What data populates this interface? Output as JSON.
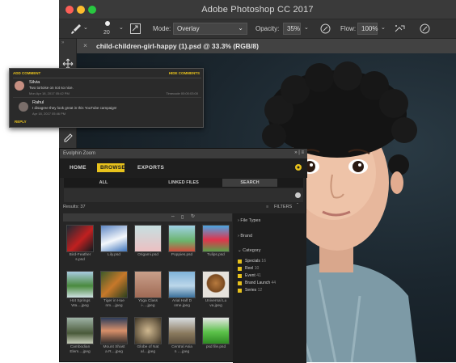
{
  "app": {
    "title": "Adobe Photoshop CC 2017"
  },
  "options": {
    "brush_size": "20",
    "mode_label": "Mode:",
    "mode_value": "Overlay",
    "opacity_label": "Opacity:",
    "opacity_value": "35%",
    "flow_label": "Flow:",
    "flow_value": "100%"
  },
  "document": {
    "tab_title": "child-children-girl-happy (1).psd @ 33.3% (RGB/8)"
  },
  "comments": {
    "add_label": "ADD COMMENT",
    "hide_label": "HIDE COMMENTS",
    "items": [
      {
        "author": "Silvia",
        "text": "Two tortoise on not so nice.",
        "date": "Mon Apr 18, 2017 05:42 PM",
        "timecode": "Timecode 00:00:03:00"
      },
      {
        "author": "Rahul",
        "text": "I disagree they look great in this YouTube campaign!",
        "date": "Apr 18, 2017 05:46 PM"
      }
    ],
    "reply_label": "REPLY"
  },
  "evolphin": {
    "panel_title": "Evolphin Zoom",
    "nav": {
      "home": "HOME",
      "browse": "BROWSE",
      "exports": "EXPORTS"
    },
    "subtabs": {
      "all": "ALL",
      "linked": "LINKED FILES",
      "search": "SEARCH"
    },
    "results_label": "Results: 37",
    "filters_label": "FILTERS",
    "thumbnails": [
      {
        "label": "Bird-Feather\ns.psd"
      },
      {
        "label": "Lily.psd"
      },
      {
        "label": "Origami.psd"
      },
      {
        "label": "Poppies.psd"
      },
      {
        "label": "Tulips.psd"
      },
      {
        "label": "Hot Springs\nWa....jpeg"
      },
      {
        "label": "Tiger in Hue\nnm....jpeg"
      },
      {
        "label": "Yoga Class\ni-....jpeg"
      },
      {
        "label": "Arial Half D\nome.jpeg"
      },
      {
        "label": "Universal Lu\nva.jpeg"
      },
      {
        "label": "Cambodian\nElem....jpeg"
      },
      {
        "label": "Mount Shast\na R....jpeg"
      },
      {
        "label": "Globe of Nat\nal....jpeg"
      },
      {
        "label": "Central Asia\nn ....jpeg"
      },
      {
        "label": "psd file.psd"
      }
    ],
    "filter_sections": {
      "file_types": "File Types",
      "brand": "Brand",
      "category": "Category"
    },
    "categories": [
      {
        "name": "Specials",
        "count": "16"
      },
      {
        "name": "Reel",
        "count": "10"
      },
      {
        "name": "Event",
        "count": "41"
      },
      {
        "name": "Brand Launch",
        "count": "44"
      },
      {
        "name": "Series",
        "count": "12"
      }
    ]
  },
  "colors": {
    "accent_yellow": "#e8c21c",
    "traffic_red": "#fc5f57",
    "traffic_yellow": "#fdbc2e",
    "traffic_green": "#28c840"
  }
}
